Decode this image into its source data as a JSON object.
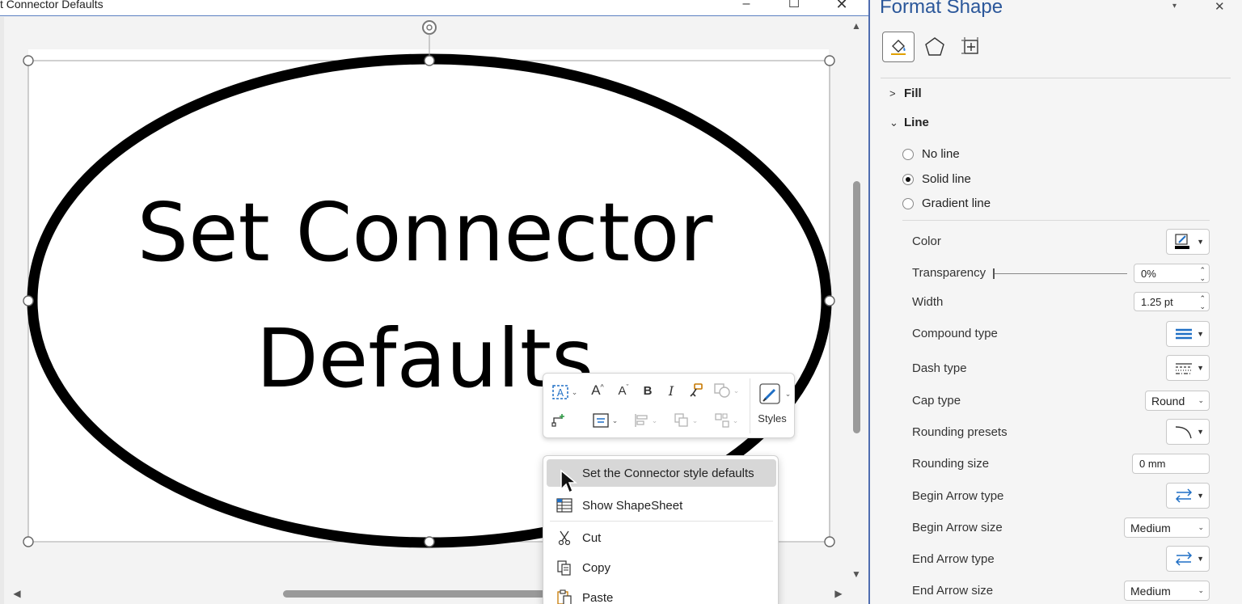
{
  "window": {
    "title": "t Connector Defaults",
    "controls": {
      "minimize": "–",
      "maximize": "☐",
      "close": "✕"
    }
  },
  "shape": {
    "text_line1": "Set Connector",
    "text_line2": "Defaults"
  },
  "mini_toolbar": {
    "styles_label": "Styles"
  },
  "context_menu": {
    "items": [
      {
        "label": "Set the Connector style defaults",
        "highlighted": true
      },
      {
        "label": "Show ShapeSheet"
      },
      {
        "label": "Cut"
      },
      {
        "label": "Copy"
      },
      {
        "label": "Paste"
      }
    ]
  },
  "format_pane": {
    "title": "Format Shape",
    "sections": {
      "fill": "Fill",
      "line": "Line"
    },
    "line_options": [
      {
        "label": "No line",
        "selected": false
      },
      {
        "label": "Solid line",
        "selected": true
      },
      {
        "label": "Gradient line",
        "selected": false
      }
    ],
    "properties": {
      "color": {
        "label": "Color"
      },
      "transparency": {
        "label": "Transparency",
        "value": "0%"
      },
      "width": {
        "label": "Width",
        "value": "1.25 pt"
      },
      "compound_type": {
        "label": "Compound type"
      },
      "dash_type": {
        "label": "Dash type"
      },
      "cap_type": {
        "label": "Cap type",
        "value": "Round"
      },
      "rounding_presets": {
        "label": "Rounding presets"
      },
      "rounding_size": {
        "label": "Rounding size",
        "value": "0 mm"
      },
      "begin_arrow_type": {
        "label": "Begin Arrow type"
      },
      "begin_arrow_size": {
        "label": "Begin Arrow size",
        "value": "Medium"
      },
      "end_arrow_type": {
        "label": "End Arrow type"
      },
      "end_arrow_size": {
        "label": "End Arrow size",
        "value": "Medium"
      }
    }
  },
  "colors": {
    "accent": "#2b579a",
    "pane_border": "#4f6db0",
    "menu_highlight": "#d7d7d7"
  }
}
